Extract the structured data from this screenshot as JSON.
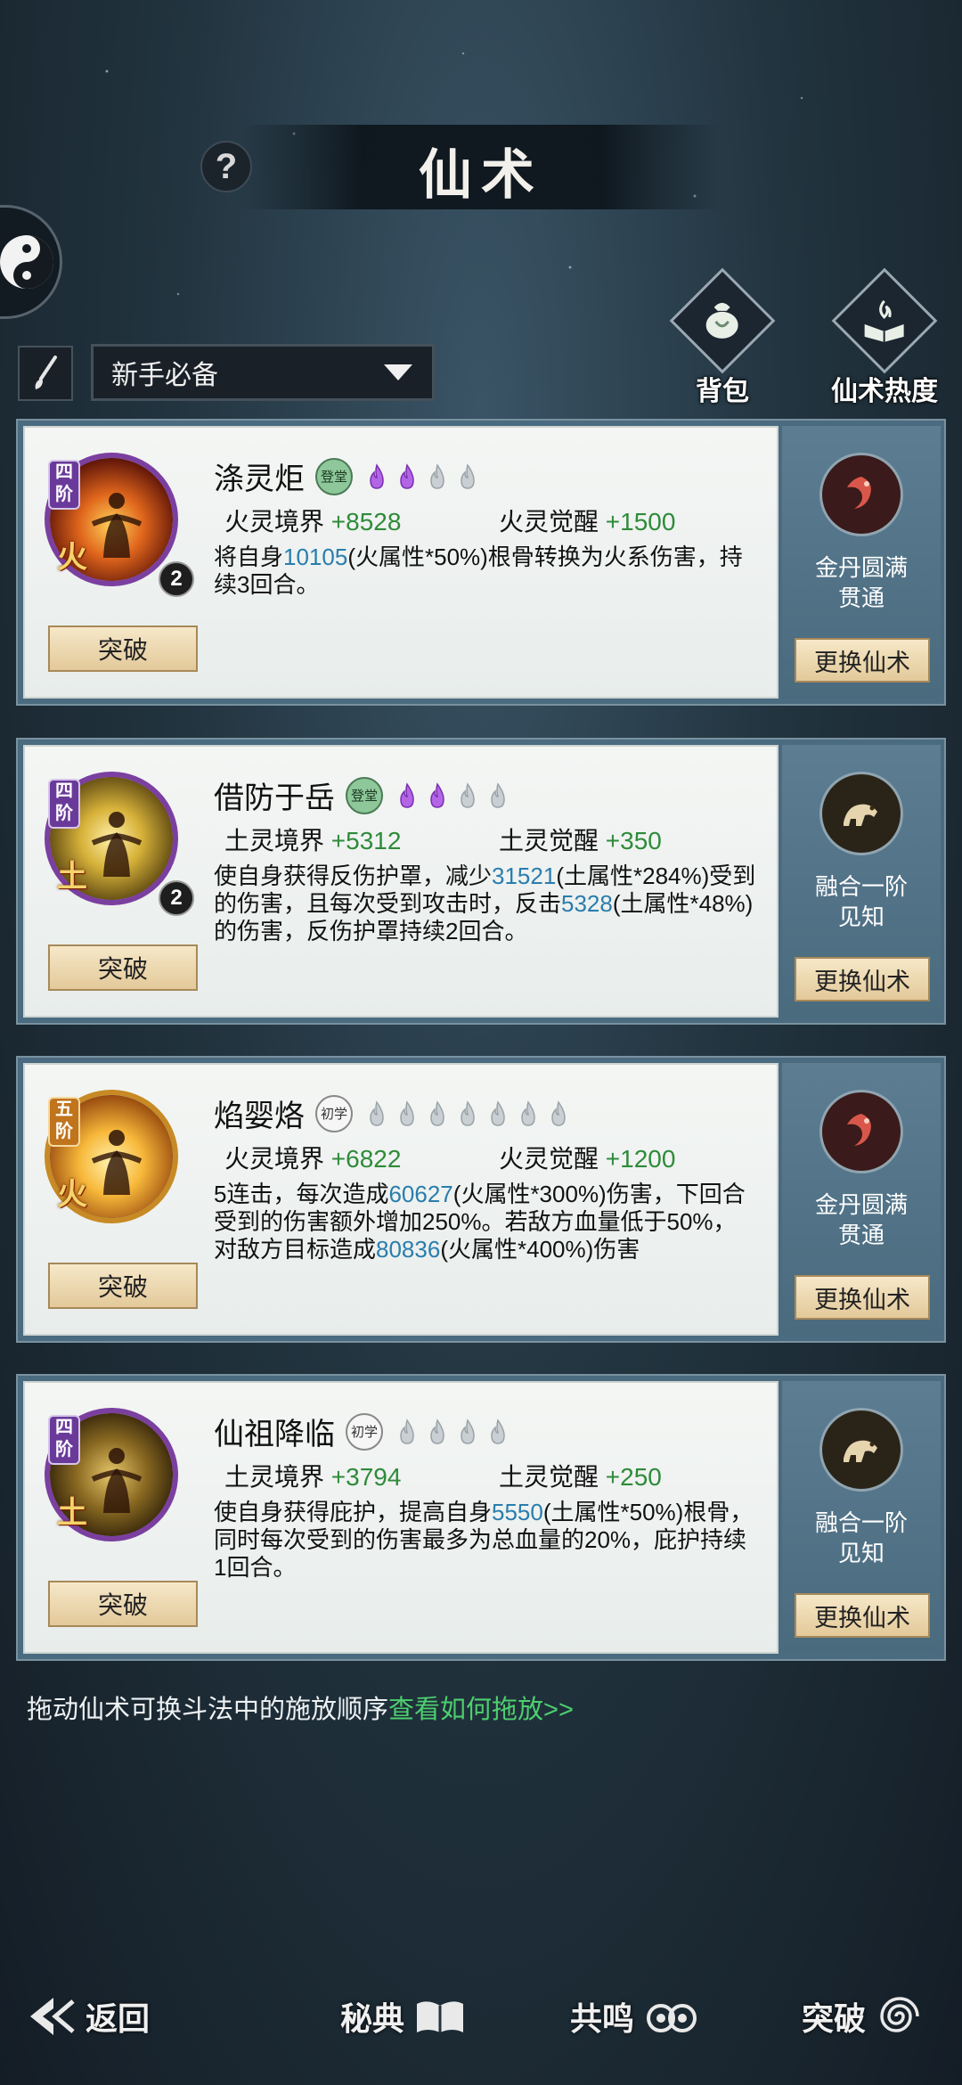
{
  "header": {
    "title": "仙术",
    "help_label": "?"
  },
  "filter": {
    "selected": "新手必备"
  },
  "side_buttons": {
    "bag": "背包",
    "popularity": "仙术热度"
  },
  "cards": [
    {
      "tier": "四阶",
      "element": "火",
      "count": "2",
      "name": "涤灵炬",
      "rank": "登堂",
      "stat1_label": "火灵境界",
      "stat1_value": "+8528",
      "stat2_label": "火灵觉醒",
      "stat2_value": "+1500",
      "desc": [
        {
          "t": "将自身"
        },
        {
          "t": "10105",
          "n": true
        },
        {
          "t": "(火属性*50%)根骨转换为火系伤害，持续3回合。"
        }
      ],
      "break_label": "突破",
      "fx_line1": "金丹圆满",
      "fx_line2": "贯通",
      "swap_label": "更换仙术",
      "flames_filled": 2,
      "flames_total": 4
    },
    {
      "tier": "四阶",
      "element": "土",
      "count": "2",
      "name": "借防于岳",
      "rank": "登堂",
      "stat1_label": "土灵境界",
      "stat1_value": "+5312",
      "stat2_label": "土灵觉醒",
      "stat2_value": "+350",
      "desc": [
        {
          "t": "使自身获得反伤护罩，减少"
        },
        {
          "t": "31521",
          "n": true
        },
        {
          "t": "(土属性*284%)受到的伤害，且每次受到攻击时，反击"
        },
        {
          "t": "5328",
          "n": true
        },
        {
          "t": "(土属性*48%)的伤害，反伤护罩持续2回合。"
        }
      ],
      "break_label": "突破",
      "fx_line1": "融合一阶",
      "fx_line2": "见知",
      "swap_label": "更换仙术",
      "flames_filled": 2,
      "flames_total": 4
    },
    {
      "tier": "五阶",
      "element": "火",
      "count": "",
      "name": "焰婴烙",
      "rank": "初学",
      "stat1_label": "火灵境界",
      "stat1_value": "+6822",
      "stat2_label": "火灵觉醒",
      "stat2_value": "+1200",
      "desc": [
        {
          "t": "5连击，每次造成"
        },
        {
          "t": "60627",
          "n": true
        },
        {
          "t": "(火属性*300%)伤害，下回合受到的伤害额外增加250%。若敌方血量低于50%，对敌方目标造成"
        },
        {
          "t": "80836",
          "n": true
        },
        {
          "t": "(火属性*400%)伤害"
        }
      ],
      "break_label": "突破",
      "fx_line1": "金丹圆满",
      "fx_line2": "贯通",
      "swap_label": "更换仙术",
      "flames_filled": 0,
      "flames_total": 7
    },
    {
      "tier": "四阶",
      "element": "土",
      "count": "",
      "name": "仙祖降临",
      "rank": "初学",
      "stat1_label": "土灵境界",
      "stat1_value": "+3794",
      "stat2_label": "土灵觉醒",
      "stat2_value": "+250",
      "desc": [
        {
          "t": "使自身获得庇护，提高自身"
        },
        {
          "t": "5550",
          "n": true
        },
        {
          "t": "(土属性*50%)根骨，同时每次受到的伤害最多为总血量的20%，庇护持续1回合。"
        }
      ],
      "break_label": "突破",
      "fx_line1": "融合一阶",
      "fx_line2": "见知",
      "swap_label": "更换仙术",
      "flames_filled": 0,
      "flames_total": 4
    }
  ],
  "hint": {
    "text": "拖动仙术可换斗法中的施放顺序",
    "link": "查看如何拖放>>"
  },
  "bottom_nav": {
    "back": "返回",
    "secret": "秘典",
    "resonance": "共鸣",
    "breakthrough": "突破"
  },
  "colors": {
    "accent_green": "#2e8b3a",
    "number_blue": "#2a7dad",
    "card_bg": "#4a6b80"
  }
}
